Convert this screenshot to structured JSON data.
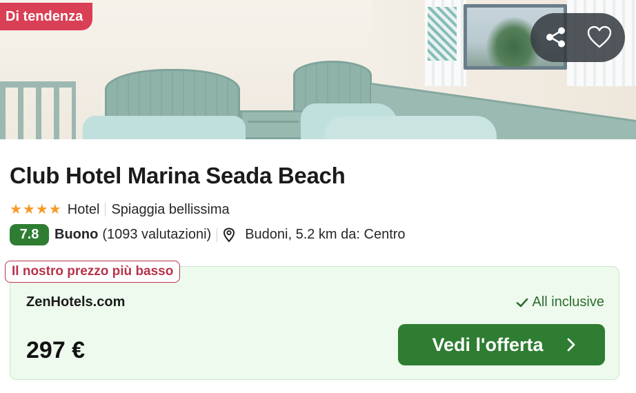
{
  "photo": {
    "badge": "Di tendenza",
    "share_icon": "share-icon",
    "favorite_icon": "heart-icon"
  },
  "hotel": {
    "name": "Club Hotel Marina Seada Beach",
    "stars": 4,
    "type": "Hotel",
    "highlight": "Spiaggia bellissima",
    "score": "7.8",
    "verdict": "Buono",
    "reviews": "(1093 valutazioni)",
    "location": "Budoni, 5.2 km da: Centro",
    "location_icon": "map-pin-icon"
  },
  "offer": {
    "tag": "Il nostro prezzo più basso",
    "provider": "ZenHotels.com",
    "amenity": "All inclusive",
    "amenity_icon": "check-icon",
    "price": "297 €",
    "cta_label": "Vedi l'offerta",
    "cta_icon": "chevron-right-icon"
  },
  "colors": {
    "badge_red": "#d93f55",
    "score_green": "#2e7d32",
    "offer_bg": "#edfaed",
    "tag_red": "#b8334a",
    "star_orange": "#f59a28"
  }
}
